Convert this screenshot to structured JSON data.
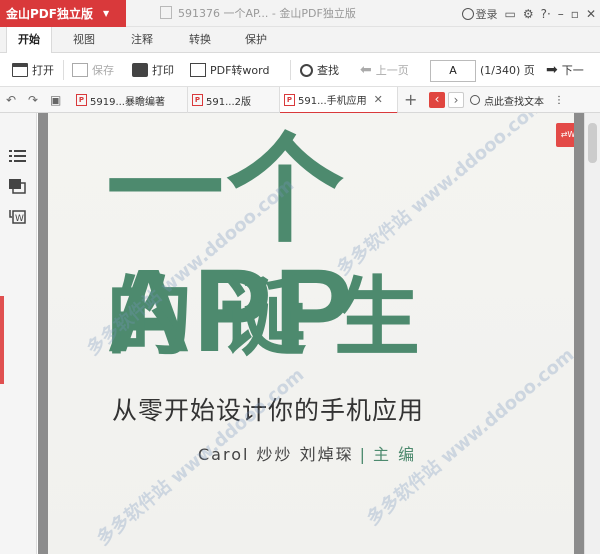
{
  "app": {
    "brand": "金山PDF独立版",
    "window_title": "591376 一个AP...  - 金山PDF独立版",
    "login_label": "登录"
  },
  "menu": {
    "tabs": [
      {
        "label": "开始",
        "active": true
      },
      {
        "label": "视图"
      },
      {
        "label": "注释"
      },
      {
        "label": "转换"
      },
      {
        "label": "保护"
      }
    ]
  },
  "toolbar": {
    "open": "打开",
    "save": "保存",
    "print": "打印",
    "pdf_to_word": "PDF转word",
    "find": "查找",
    "prev_page": "上一页",
    "page_value": "A",
    "page_count": "(1/340) 页",
    "next_page": "下一"
  },
  "doc_tabs": [
    {
      "label": "5919...暴瞻编著",
      "active": false
    },
    {
      "label": "591...2版",
      "active": false
    },
    {
      "label": "591...手机应用",
      "active": true
    }
  ],
  "find_text": "点此查找文本",
  "page_content": {
    "title_line1": "一个APP",
    "title_line2": "的诞生",
    "subtitle": "从零开始设计你的手机应用",
    "authors": "Carol 炒炒   刘焯琛",
    "role": "主 编"
  },
  "watermark": "多多软件站 www.ddooo.com",
  "colors": {
    "brand_red": "#d9393b",
    "title_green": "#4d8a6e"
  }
}
